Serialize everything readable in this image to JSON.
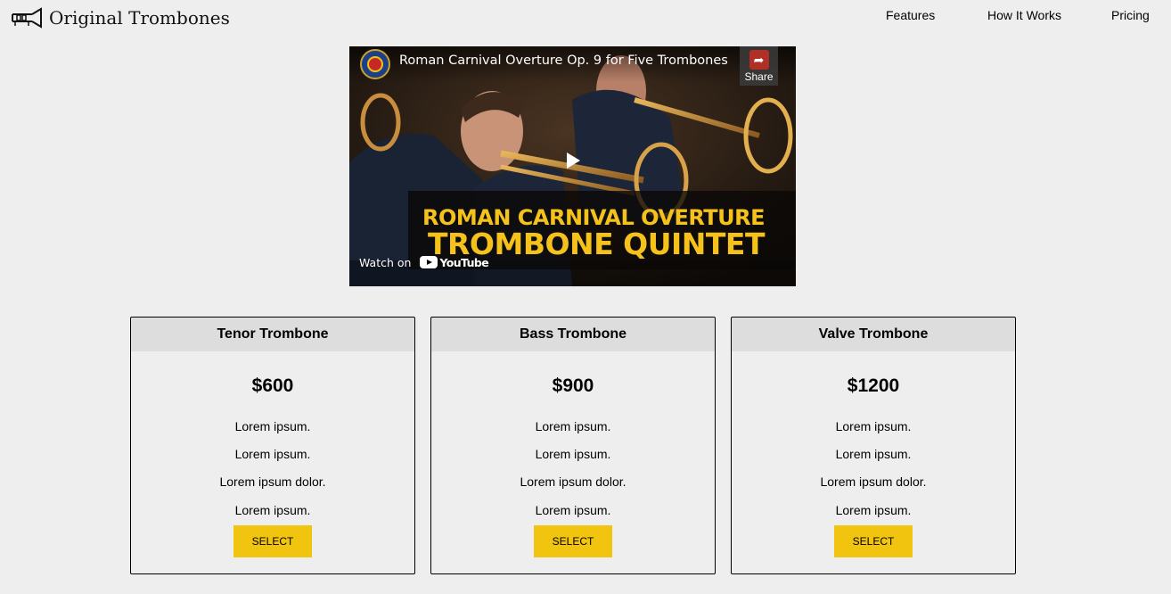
{
  "header": {
    "brand": "Original Trombones",
    "nav": [
      "Features",
      "How It Works",
      "Pricing"
    ]
  },
  "video": {
    "title": "Roman Carnival Overture Op. 9 for Five Trombones",
    "share_label": "Share",
    "banner_line1": "ROMAN CARNIVAL OVERTURE",
    "banner_line2": "TROMBONE QUINTET",
    "watch_on": "Watch on",
    "youtube": "YouTube"
  },
  "pricing": [
    {
      "name": "Tenor Trombone",
      "price": "$600",
      "features": [
        "Lorem ipsum.",
        "Lorem ipsum.",
        "Lorem ipsum dolor.",
        "Lorem ipsum."
      ],
      "button": "SELECT"
    },
    {
      "name": "Bass Trombone",
      "price": "$900",
      "features": [
        "Lorem ipsum.",
        "Lorem ipsum.",
        "Lorem ipsum dolor.",
        "Lorem ipsum."
      ],
      "button": "SELECT"
    },
    {
      "name": "Valve Trombone",
      "price": "$1200",
      "features": [
        "Lorem ipsum.",
        "Lorem ipsum.",
        "Lorem ipsum dolor.",
        "Lorem ipsum."
      ],
      "button": "SELECT"
    }
  ],
  "colors": {
    "background": "#eeeeee",
    "card_header": "#dddddd",
    "accent": "#f1c40f",
    "banner_text": "#f5c21b"
  },
  "icons": {
    "logo": "trombone-logo-icon",
    "play": "play-icon",
    "share": "share-icon",
    "youtube": "youtube-icon"
  }
}
